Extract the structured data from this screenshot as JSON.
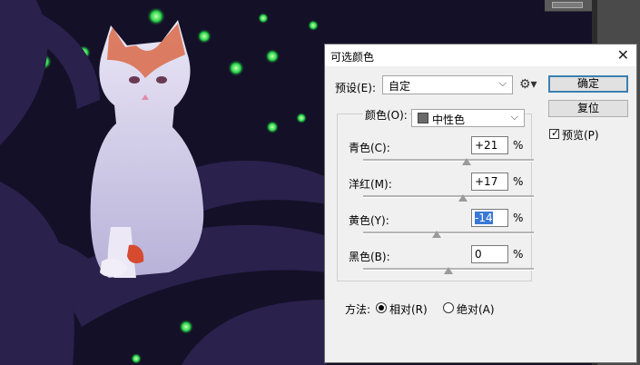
{
  "dialog": {
    "title": "可选颜色",
    "close_icon": "close-icon",
    "preset": {
      "label": "预设(E):",
      "value": "自定"
    },
    "buttons": {
      "ok": "确定",
      "reset": "复位"
    },
    "preview": {
      "label": "预览(P)",
      "checked": true
    },
    "color": {
      "label": "颜色(O):",
      "value": "中性色",
      "swatch": "#6b6b6b"
    },
    "sliders": [
      {
        "label": "青色(C):",
        "value": "+21",
        "unit": "%",
        "percent": 21
      },
      {
        "label": "洋红(M):",
        "value": "+17",
        "unit": "%",
        "percent": 17
      },
      {
        "label": "黄色(Y):",
        "value": "-14",
        "unit": "%",
        "percent": -14
      },
      {
        "label": "黑色(B):",
        "value": "0",
        "unit": "%",
        "percent": 0
      }
    ],
    "method": {
      "label": "方法:",
      "options": [
        {
          "label": "相对(R)",
          "selected": true
        },
        {
          "label": "绝对(A)",
          "selected": false
        }
      ]
    }
  },
  "colors": {
    "accent": "#3c7fb1",
    "selection": "#3a78d6",
    "tree": "#251c45",
    "leaf": "#29d64c"
  }
}
